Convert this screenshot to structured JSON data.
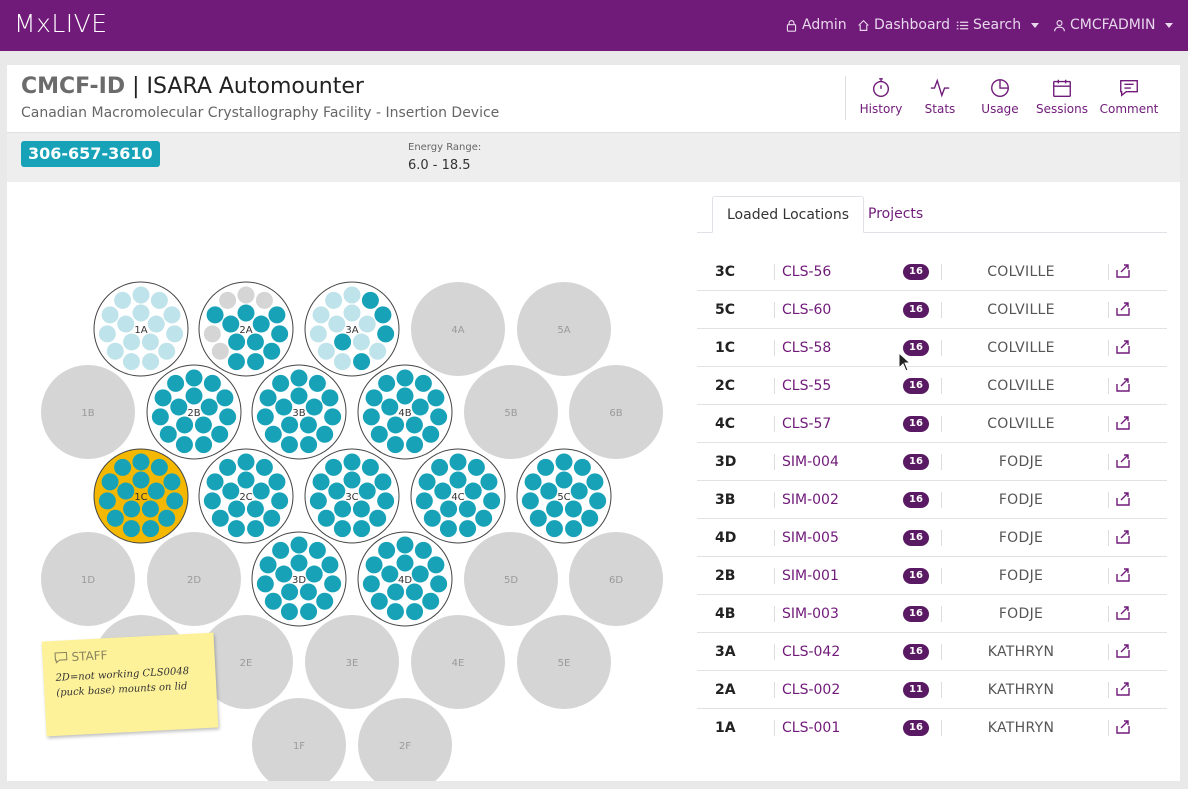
{
  "navbar": {
    "brand": "MxLIVE",
    "items": [
      {
        "label": "Admin",
        "icon": "lock-icon"
      },
      {
        "label": "Dashboard",
        "icon": "home-icon"
      },
      {
        "label": "Search",
        "icon": "list-icon"
      },
      {
        "label": "CMCFADMIN",
        "icon": "user-icon"
      }
    ]
  },
  "header": {
    "acronym": "CMCF-ID",
    "separator": " | ",
    "name": "ISARA Automounter",
    "subtitle": "Canadian Macromolecular Crystallography Facility - Insertion Device",
    "tools": [
      {
        "label": "History",
        "icon": "stopwatch-icon"
      },
      {
        "label": "Stats",
        "icon": "activity-icon"
      },
      {
        "label": "Usage",
        "icon": "pie-chart-icon"
      },
      {
        "label": "Sessions",
        "icon": "calendar-icon"
      },
      {
        "label": "Comment",
        "icon": "comment-icon"
      }
    ]
  },
  "info": {
    "phone": "306-657-3610",
    "energy_label": "Energy Range:",
    "energy_value": "6.0 - 18.5"
  },
  "colors": {
    "brand": "#701a79",
    "sample": "#17a2b8",
    "sample_light": "#bfe3ea",
    "slot_empty": "#d5d5d5",
    "selected": "#f5b800",
    "badge": "#5a1a63"
  },
  "dewar": {
    "pucks": [
      {
        "label": "1A",
        "state": "light"
      },
      {
        "label": "2A",
        "state": "partial"
      },
      {
        "label": "3A",
        "state": "mixed"
      },
      {
        "label": "4A",
        "state": "empty"
      },
      {
        "label": "5A",
        "state": "empty"
      },
      {
        "label": "1B",
        "state": "empty"
      },
      {
        "label": "2B",
        "state": "full"
      },
      {
        "label": "3B",
        "state": "full"
      },
      {
        "label": "4B",
        "state": "full"
      },
      {
        "label": "5B",
        "state": "empty"
      },
      {
        "label": "6B",
        "state": "empty"
      },
      {
        "label": "1C",
        "state": "selected"
      },
      {
        "label": "2C",
        "state": "full"
      },
      {
        "label": "3C",
        "state": "full"
      },
      {
        "label": "4C",
        "state": "full"
      },
      {
        "label": "5C",
        "state": "full"
      },
      {
        "label": "1D",
        "state": "empty"
      },
      {
        "label": "2D",
        "state": "empty"
      },
      {
        "label": "3D",
        "state": "full"
      },
      {
        "label": "4D",
        "state": "full"
      },
      {
        "label": "5D",
        "state": "empty"
      },
      {
        "label": "6D",
        "state": "empty"
      },
      {
        "label": "1E",
        "state": "empty"
      },
      {
        "label": "2E",
        "state": "empty"
      },
      {
        "label": "3E",
        "state": "empty"
      },
      {
        "label": "4E",
        "state": "empty"
      },
      {
        "label": "5E",
        "state": "empty"
      },
      {
        "label": "1F",
        "state": "empty"
      },
      {
        "label": "2F",
        "state": "empty"
      }
    ]
  },
  "note": {
    "title": "STAFF",
    "text": "2D=not working CLS0048 (puck base) mounts on lid"
  },
  "tabs": [
    {
      "label": "Loaded Locations",
      "active": true
    },
    {
      "label": "Projects",
      "active": false
    }
  ],
  "locations": [
    {
      "loc": "3C",
      "name": "CLS-56",
      "count": "16",
      "owner": "COLVILLE"
    },
    {
      "loc": "5C",
      "name": "CLS-60",
      "count": "16",
      "owner": "COLVILLE"
    },
    {
      "loc": "1C",
      "name": "CLS-58",
      "count": "16",
      "owner": "COLVILLE"
    },
    {
      "loc": "2C",
      "name": "CLS-55",
      "count": "16",
      "owner": "COLVILLE"
    },
    {
      "loc": "4C",
      "name": "CLS-57",
      "count": "16",
      "owner": "COLVILLE"
    },
    {
      "loc": "3D",
      "name": "SIM-004",
      "count": "16",
      "owner": "FODJE"
    },
    {
      "loc": "3B",
      "name": "SIM-002",
      "count": "16",
      "owner": "FODJE"
    },
    {
      "loc": "4D",
      "name": "SIM-005",
      "count": "16",
      "owner": "FODJE"
    },
    {
      "loc": "2B",
      "name": "SIM-001",
      "count": "16",
      "owner": "FODJE"
    },
    {
      "loc": "4B",
      "name": "SIM-003",
      "count": "16",
      "owner": "FODJE"
    },
    {
      "loc": "3A",
      "name": "CLS-042",
      "count": "16",
      "owner": "KATHRYN"
    },
    {
      "loc": "2A",
      "name": "CLS-002",
      "count": "11",
      "owner": "KATHRYN"
    },
    {
      "loc": "1A",
      "name": "CLS-001",
      "count": "16",
      "owner": "KATHRYN"
    }
  ]
}
